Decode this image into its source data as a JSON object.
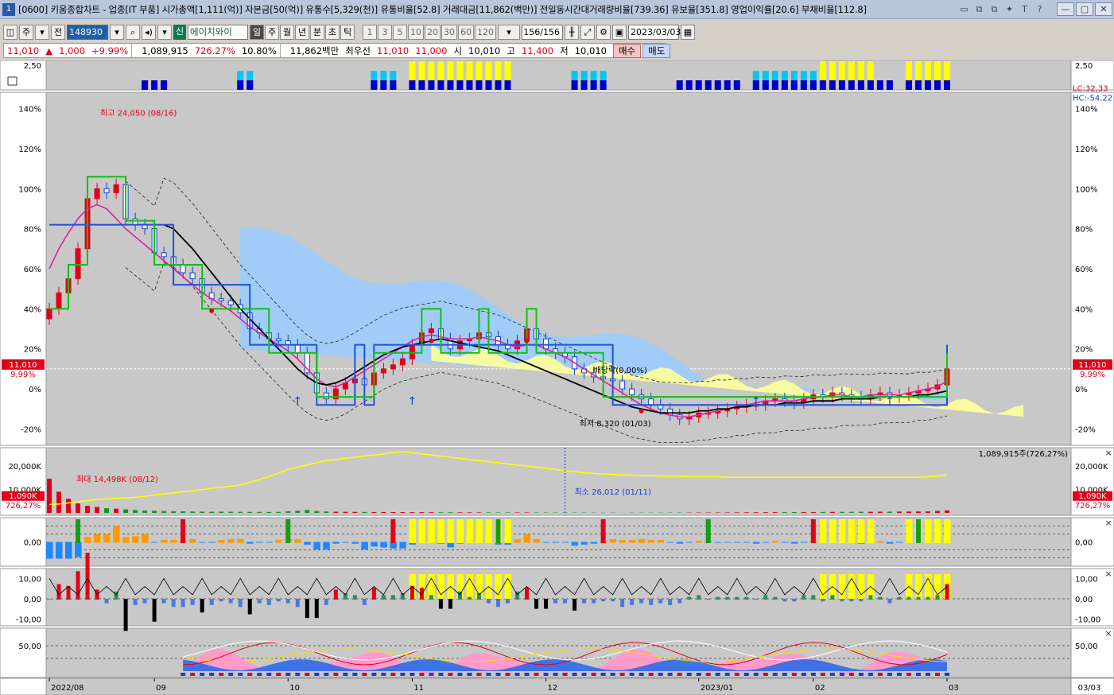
{
  "window": {
    "number": "1",
    "title": "[0600] 키움종합차트 - 업종[IT 부품] 시가총액[1,111(억)] 자본금[50(억)] 유통수[5,329(천)] 유통비율[52.8] 거래대금[11,862(백만)] 전일동시간대거래량비율[739.36] 유보율[351.8] 영업이익률[20.6] 부채비율[112.8]"
  },
  "toolbar": {
    "period_main": "주",
    "prev_label": "전",
    "code": "148930",
    "shin_label": "신",
    "stock_name": "에이치와이",
    "periods": [
      "일",
      "주",
      "월",
      "년",
      "분",
      "초",
      "틱"
    ],
    "active_period": "일",
    "minute_units": [
      "1",
      "3",
      "5",
      "10",
      "20",
      "30",
      "60",
      "120"
    ],
    "count": "156/156",
    "date": "2023/03/03"
  },
  "quote": {
    "price": "11,010",
    "change": "1,000",
    "change_rate": "+9.99%",
    "volume": "1,089,915",
    "volume_ratio": "726.27%",
    "turnover": "10.80%",
    "amount": "11,862백만",
    "best_label": "최우선",
    "best_ask": "11,010",
    "best_bid": "11,000",
    "open_label": "시",
    "open": "10,010",
    "high_label": "고",
    "high": "11,400",
    "low_label": "저",
    "low": "10,010",
    "buy_label": "매수",
    "sell_label": "매도"
  },
  "chart_data": [
    {
      "type": "bar",
      "panel": "signal-strip",
      "ylabel_left": "2,50",
      "ylabel_right": "2,50"
    },
    {
      "type": "line",
      "panel": "price",
      "y_ticks": [
        "140%",
        "120%",
        "100%",
        "80%",
        "60%",
        "40%",
        "20%",
        "0%",
        "-20%"
      ],
      "y_range": [
        -25,
        145
      ],
      "current_price_label": "11,010",
      "current_rate_label": "9,99%",
      "right_top_labels": [
        "LC:32,33",
        "HC:-54,22"
      ],
      "annotations": {
        "high": "최고 24,050 (08/16)",
        "low": "최저 8,320 (01/03)",
        "dividend": "배당락(0,00%)"
      },
      "close": [
        40,
        48,
        55,
        70,
        95,
        100,
        98,
        102,
        85,
        82,
        80,
        68,
        66,
        62,
        58,
        55,
        48,
        45,
        44,
        42,
        38,
        30,
        28,
        25,
        24,
        22,
        18,
        8,
        -2,
        -5,
        0,
        3,
        5,
        2,
        8,
        10,
        12,
        15,
        22,
        28,
        30,
        25,
        20,
        24,
        25,
        28,
        26,
        22,
        20,
        24,
        30,
        25,
        20,
        18,
        16,
        10,
        8,
        6,
        5,
        4,
        0,
        -3,
        -5,
        -8,
        -10,
        -13,
        -15,
        -14,
        -12,
        -12,
        -11,
        -10,
        -9,
        -8,
        -8,
        -6,
        -5,
        -6,
        -7,
        -5,
        -3,
        -4,
        -2,
        -3,
        -4,
        -5,
        -3,
        -2,
        -4,
        -3,
        -2,
        -1,
        0,
        2,
        10
      ],
      "ma_pink": [
        60,
        70,
        78,
        85,
        90,
        92,
        90,
        85,
        80,
        76,
        72,
        68,
        64,
        60,
        56,
        52,
        48,
        45,
        42,
        39,
        35,
        31,
        28,
        25,
        22,
        19,
        15,
        10,
        5,
        2,
        1,
        3,
        6,
        9,
        12,
        15,
        18,
        21,
        24,
        26,
        27,
        26,
        25,
        25,
        25,
        26,
        25,
        24,
        22,
        21,
        22,
        22,
        20,
        18,
        16,
        13,
        10,
        7,
        4,
        1,
        -2,
        -5,
        -8,
        -10,
        -12,
        -13,
        -14,
        -14,
        -13,
        -12,
        -11,
        -10,
        -9,
        -8,
        -7,
        -6,
        -6,
        -6,
        -6,
        -5,
        -4,
        -4,
        -3,
        -3,
        -4,
        -4,
        -3,
        -3,
        -3,
        -3,
        -2,
        -1,
        0,
        1,
        4
      ],
      "ma_black": [
        null,
        null,
        null,
        null,
        null,
        null,
        null,
        null,
        null,
        null,
        null,
        null,
        82,
        80,
        75,
        70,
        64,
        58,
        52,
        46,
        40,
        35,
        30,
        25,
        20,
        15,
        10,
        6,
        3,
        2,
        3,
        5,
        8,
        11,
        14,
        17,
        19,
        21,
        22,
        23,
        24,
        25,
        24,
        23,
        22,
        21,
        20,
        19,
        17,
        15,
        13,
        11,
        9,
        7,
        5,
        3,
        1,
        -1,
        -3,
        -5,
        -7,
        -9,
        -10,
        -11,
        -12,
        -12,
        -12,
        -12,
        -11,
        -11,
        -10,
        -10,
        -9,
        -9,
        -8,
        -8,
        -8,
        -7,
        -7,
        -7,
        -6,
        -6,
        -6,
        -5,
        -5,
        -5,
        -5,
        -4,
        -4,
        -4,
        -4,
        -3,
        -3,
        -2,
        -1
      ]
    },
    {
      "type": "line",
      "panel": "volume",
      "y_ticks": [
        "20,000K",
        "10,000K"
      ],
      "current_volume_label": "1,090K",
      "current_rate_label": "726,27%",
      "top_right_label": "1,089,915주(726,27%)",
      "annotations": {
        "max": "최대 14,498K (08/12)",
        "min": "최소 26,012 (01/11)"
      },
      "volume_k": [
        14498,
        9000,
        6000,
        4000,
        3000,
        2500,
        2000,
        1800,
        1500,
        1200,
        1000,
        900,
        800,
        700,
        650,
        600,
        550,
        500,
        520,
        480,
        450,
        430,
        420,
        400,
        420,
        700,
        900,
        1200,
        800,
        600,
        500,
        450,
        420,
        400,
        380,
        350,
        340,
        320,
        300,
        300,
        280,
        260,
        250,
        240,
        230,
        220,
        210,
        200,
        200,
        190,
        180,
        170,
        160,
        150,
        150,
        140,
        130,
        120,
        110,
        100,
        26,
        90,
        100,
        110,
        120,
        130,
        140,
        150,
        160,
        170,
        180,
        200,
        220,
        240,
        260,
        280,
        300,
        320,
        340,
        360,
        380,
        400,
        420,
        440,
        460,
        480,
        500,
        520,
        540,
        560,
        580,
        600,
        620,
        800,
        1090
      ],
      "yellow_line": [
        5,
        6,
        8,
        10,
        12,
        14,
        15,
        16,
        17,
        18,
        20,
        22,
        24,
        26,
        28,
        30,
        32,
        34,
        36,
        38,
        40,
        45,
        50,
        55,
        62,
        68,
        72,
        76,
        80,
        84,
        86,
        88,
        90,
        92,
        94,
        96,
        98,
        100,
        98,
        96,
        94,
        92,
        90,
        88,
        86,
        84,
        82,
        80,
        78,
        76,
        74,
        72,
        70,
        68,
        66,
        64,
        62,
        61,
        60,
        59,
        58,
        58,
        57,
        57,
        56,
        56,
        56,
        55,
        55,
        55,
        55,
        54,
        54,
        54,
        54,
        54,
        54,
        54,
        54,
        54,
        54,
        54,
        54,
        54,
        54,
        54,
        54,
        54,
        54,
        54,
        54,
        54,
        55,
        56,
        58
      ]
    },
    {
      "type": "area",
      "panel": "indicator-1",
      "y_ticks": [
        "0,00"
      ]
    },
    {
      "type": "bar",
      "panel": "indicator-2",
      "y_ticks": [
        "10,00",
        "0,00",
        "-10,00"
      ]
    },
    {
      "type": "area",
      "panel": "indicator-3",
      "y_ticks": [
        "50,00"
      ]
    }
  ],
  "x_axis": {
    "labels": [
      "2022/08",
      "09",
      "10",
      "11",
      "12",
      "2023/01",
      "02",
      "03"
    ],
    "end_label": "03/03"
  },
  "colors": {
    "up": "#e0001a",
    "down": "#1040d0",
    "yellow": "#ffff00",
    "cyan": "#00c8f0",
    "navy": "#0000c8"
  }
}
